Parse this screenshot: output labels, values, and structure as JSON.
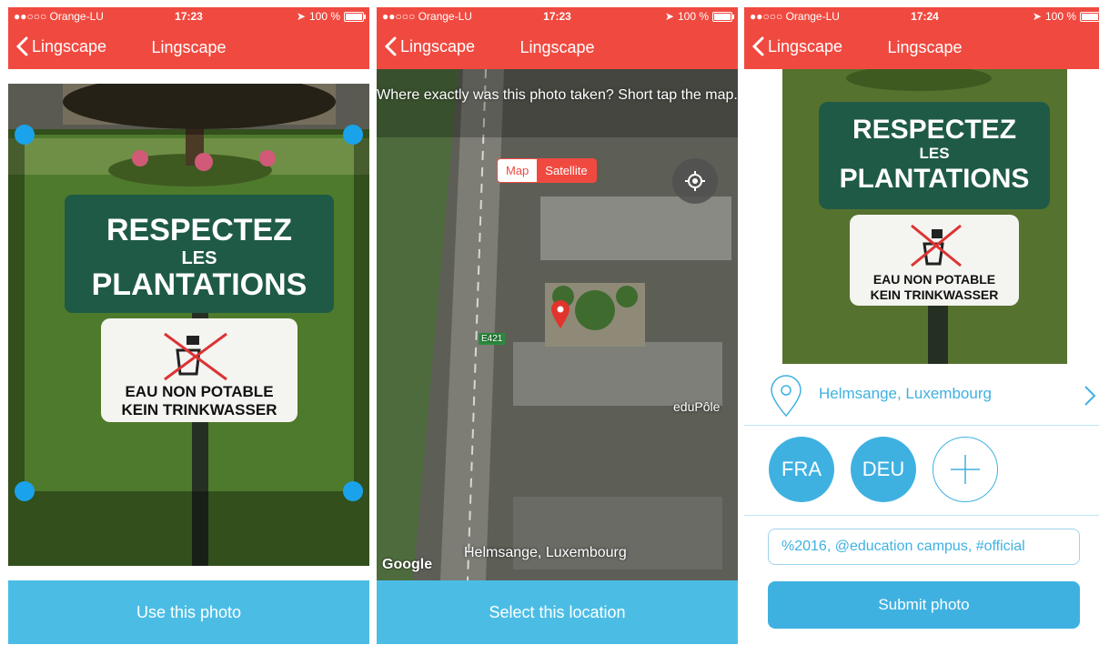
{
  "status": {
    "carrier": "●●○○○ Orange-LU",
    "battery": "100 %",
    "times": [
      "17:23",
      "17:23",
      "17:24"
    ]
  },
  "nav": {
    "back_label": "Lingscape",
    "title": "Lingscape"
  },
  "screen1": {
    "photo_sign": {
      "line1": "RESPECTEZ",
      "line2": "LES",
      "line3": "PLANTATIONS",
      "line4": "EAU NON POTABLE",
      "line5": "KEIN TRINKWASSER"
    },
    "button": "Use this photo"
  },
  "screen2": {
    "hint": "Where exactly was this photo taken? Short tap the map.",
    "map_toggle": {
      "map": "Map",
      "satellite": "Satellite",
      "selected": "Satellite"
    },
    "labels": {
      "road": "E421",
      "place": "eduPôle",
      "location": "Helmsange, Luxembourg",
      "attribution": "Google"
    },
    "button": "Select this location"
  },
  "screen3": {
    "location": "Helmsange, Luxembourg",
    "languages": [
      "FRA",
      "DEU"
    ],
    "tags_value": "%2016, @education campus, #official",
    "submit": "Submit photo"
  },
  "colors": {
    "brand_red": "#f04a40",
    "accent_blue": "#3fb1e1",
    "button_blue": "#4bbde5",
    "crop_handle": "#1aa3ea"
  }
}
